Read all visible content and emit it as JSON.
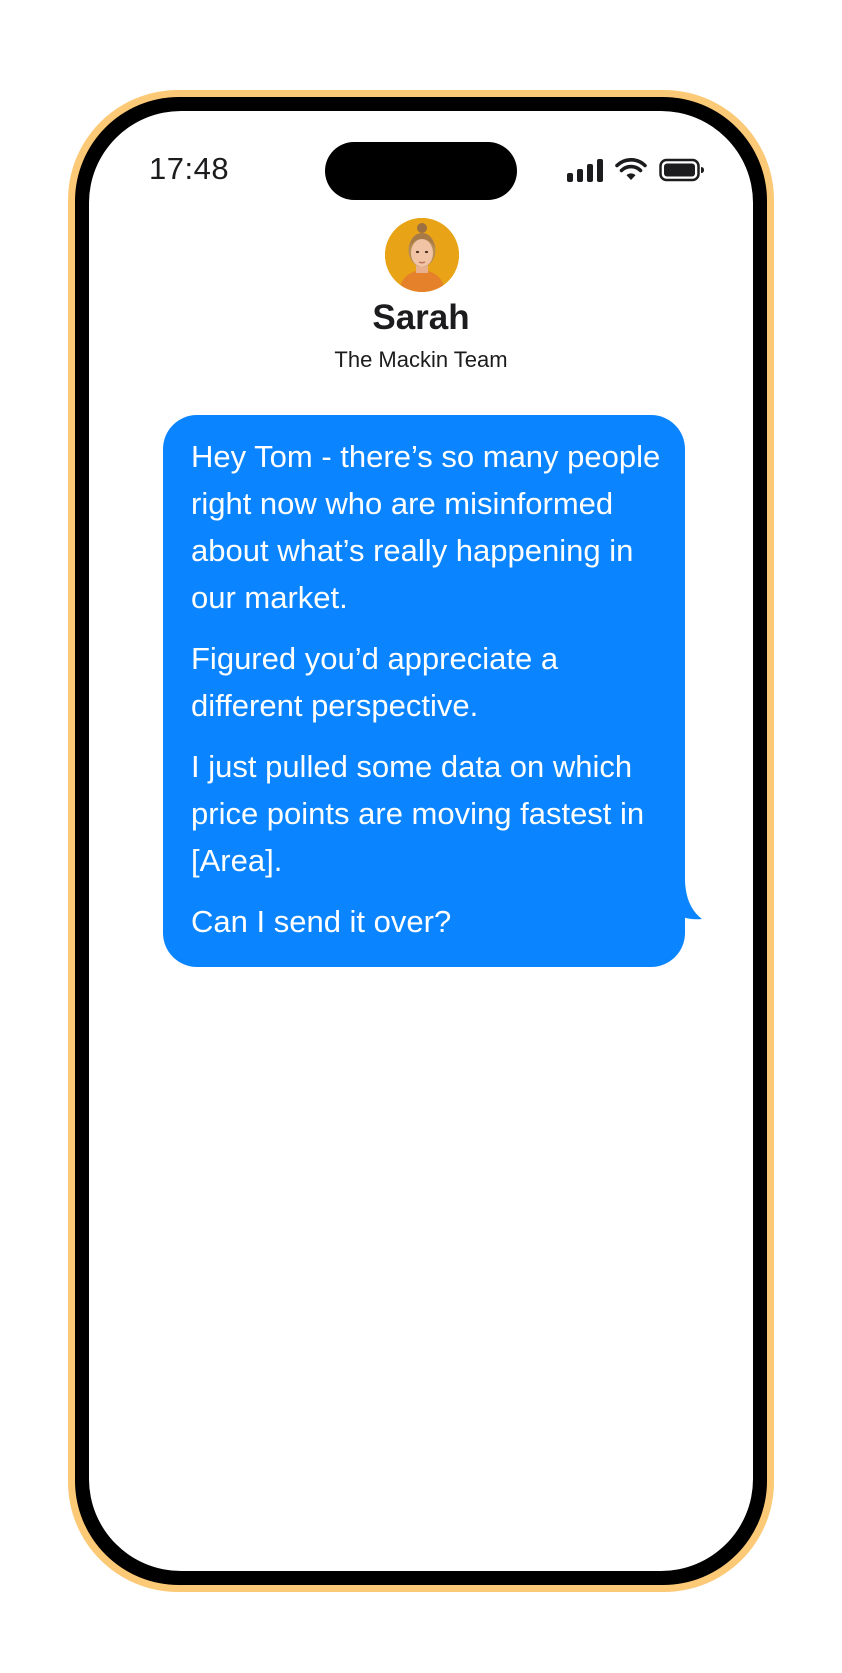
{
  "status_bar": {
    "time": "17:48",
    "signal_icon": "cellular-signal-icon",
    "wifi_icon": "wifi-icon",
    "battery_icon": "battery-icon"
  },
  "contact": {
    "avatar_icon": "contact-avatar",
    "name": "Sarah",
    "subtitle": "The Mackin Team"
  },
  "message": {
    "paragraphs": [
      "Hey Tom - there’s so many people right now who are misinformed about what’s really happening in our market.",
      "Figured you’d appreciate a different perspective.",
      "I just pulled some data on which price points are moving fastest in [Area].",
      "Can I send it over?"
    ]
  },
  "colors": {
    "frame": "#fcc976",
    "bezel": "#000000",
    "bubble": "#0a84ff",
    "text": "#1c1c1e",
    "avatar_bg": "#e8a317"
  }
}
